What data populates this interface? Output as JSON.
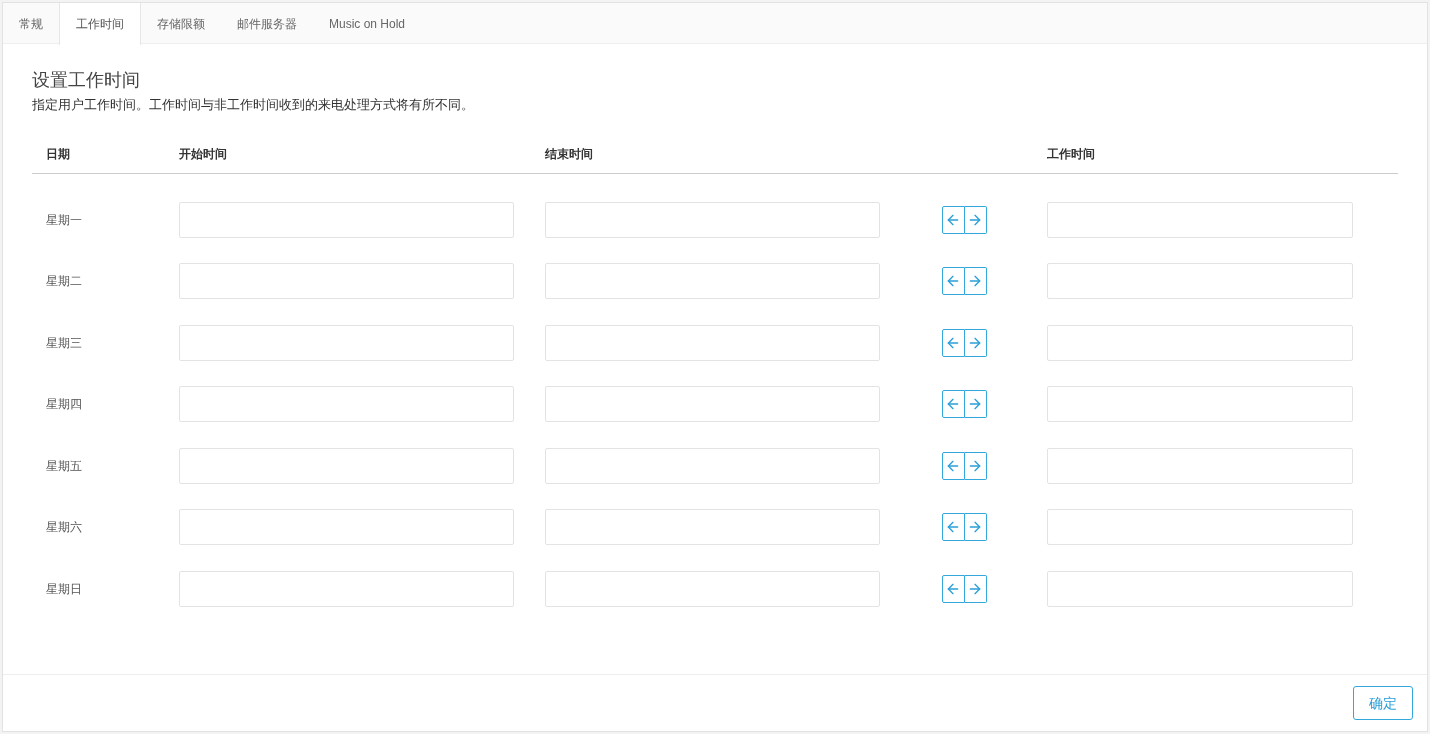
{
  "tabs": [
    {
      "label": "常规",
      "selected": false
    },
    {
      "label": "工作时间",
      "selected": true
    },
    {
      "label": "存储限额",
      "selected": false
    },
    {
      "label": "邮件服务器",
      "selected": false
    },
    {
      "label": "Music on Hold",
      "selected": false
    }
  ],
  "title": "设置工作时间",
  "description": "指定用户工作时间。工作时间与非工作时间收到的来电处理方式将有所不同。",
  "columns": {
    "day": "日期",
    "start": "开始时间",
    "end": "结束时间",
    "work": "工作时间"
  },
  "rows": [
    {
      "day": "星期一"
    },
    {
      "day": "星期二"
    },
    {
      "day": "星期三"
    },
    {
      "day": "星期四"
    },
    {
      "day": "星期五"
    },
    {
      "day": "星期六"
    },
    {
      "day": "星期日"
    }
  ],
  "confirm_button": "确定"
}
